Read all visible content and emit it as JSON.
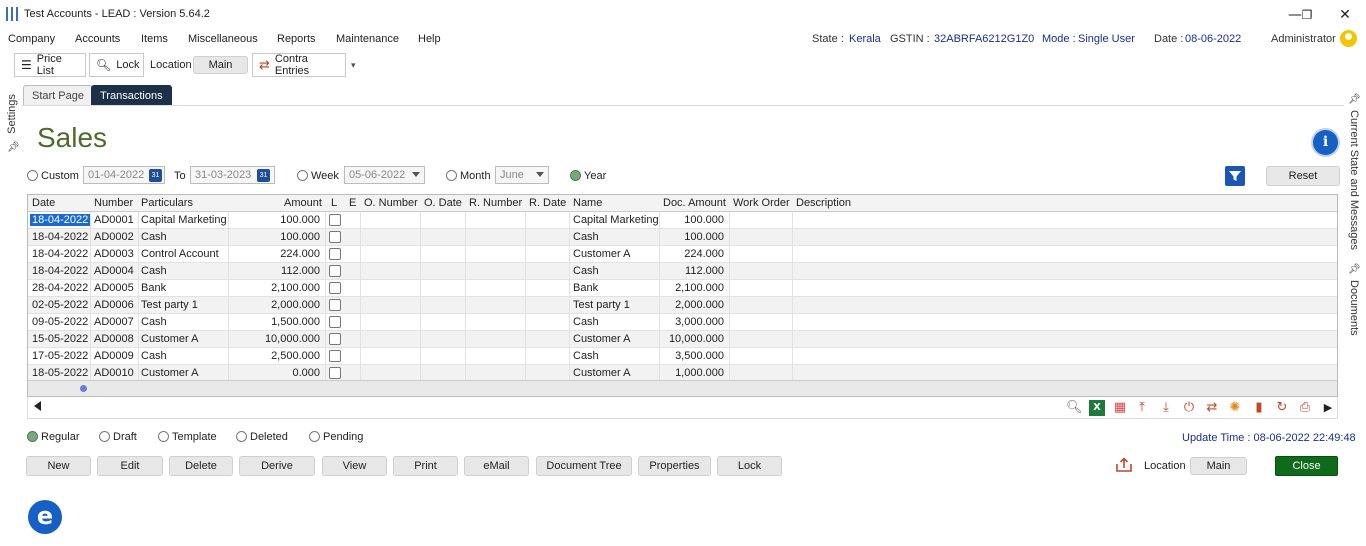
{
  "window": {
    "title": "Test Accounts - LEAD : Version 5.64.2",
    "minimize": "—",
    "maximize": "❐",
    "close": "✕"
  },
  "menu": [
    "Company",
    "Accounts",
    "Items",
    "Miscellaneous",
    "Reports",
    "Maintenance",
    "Help"
  ],
  "status": {
    "state_label": "State :",
    "state_value": "Kerala",
    "gstin_label": "GSTIN :",
    "gstin_value": "32ABRFA6212G1Z0",
    "mode_label": "Mode :",
    "mode_value": "Single User",
    "date_label": "Date :",
    "date_value": "08-06-2022",
    "user": "Administrator"
  },
  "toolbar": {
    "price_list": "Price List",
    "lock": "Lock",
    "location_label": "Location",
    "location_value": "Main",
    "contra": "Contra Entries"
  },
  "side": {
    "settings": "Settings",
    "current_state": "Current State and Messages",
    "documents": "Documents"
  },
  "tabs": [
    "Start Page",
    "Transactions"
  ],
  "page_title": "Sales",
  "filters": {
    "custom": "Custom",
    "from_date": "01-04-2022",
    "to_label": "To",
    "to_date": "31-03-2023",
    "cal_icon_text": "31",
    "week": "Week",
    "week_value": "05-06-2022",
    "month": "Month",
    "month_value": "June",
    "year": "Year",
    "selected": "year",
    "reset": "Reset"
  },
  "table": {
    "columns": [
      "Date",
      "Number",
      "Particulars",
      "Amount",
      "L",
      "E",
      "O. Number",
      "O. Date",
      "R. Number",
      "R. Date",
      "Name",
      "Doc. Amount",
      "Work Order",
      "Description"
    ],
    "rows": [
      {
        "date": "18-04-2022",
        "number": "AD0001",
        "particulars": "Capital Marketing",
        "amount": "100.000",
        "name": "Capital Marketing",
        "doc_amount": "100.000"
      },
      {
        "date": "18-04-2022",
        "number": "AD0002",
        "particulars": "Cash",
        "amount": "100.000",
        "name": "Cash",
        "doc_amount": "100.000"
      },
      {
        "date": "18-04-2022",
        "number": "AD0003",
        "particulars": "Control Account",
        "amount": "224.000",
        "name": "Customer A",
        "doc_amount": "224.000"
      },
      {
        "date": "18-04-2022",
        "number": "AD0004",
        "particulars": "Cash",
        "amount": "112.000",
        "name": "Cash",
        "doc_amount": "112.000"
      },
      {
        "date": "28-04-2022",
        "number": "AD0005",
        "particulars": "Bank",
        "amount": "2,100.000",
        "name": "Bank",
        "doc_amount": "2,100.000"
      },
      {
        "date": "02-05-2022",
        "number": "AD0006",
        "particulars": "Test party 1",
        "amount": "2,000.000",
        "name": "Test party 1",
        "doc_amount": "2,000.000"
      },
      {
        "date": "09-05-2022",
        "number": "AD0007",
        "particulars": "Cash",
        "amount": "1,500.000",
        "name": "Cash",
        "doc_amount": "3,000.000"
      },
      {
        "date": "15-05-2022",
        "number": "AD0008",
        "particulars": "Customer A",
        "amount": "10,000.000",
        "name": "Customer A",
        "doc_amount": "10,000.000"
      },
      {
        "date": "17-05-2022",
        "number": "AD0009",
        "particulars": "Cash",
        "amount": "2,500.000",
        "name": "Cash",
        "doc_amount": "3,500.000"
      },
      {
        "date": "18-05-2022",
        "number": "AD0010",
        "particulars": "Customer A",
        "amount": "0.000",
        "name": "Customer A",
        "doc_amount": "1,000.000"
      }
    ]
  },
  "nav_icons": [
    "search-icon",
    "excel-icon",
    "grid-icon",
    "move-top-icon",
    "move-bottom-icon",
    "power-icon",
    "swap-icon",
    "settings-burst-icon",
    "chart-icon",
    "refresh-icon",
    "print-icon",
    "next-icon"
  ],
  "status_filters": {
    "regular": "Regular",
    "draft": "Draft",
    "template": "Template",
    "deleted": "Deleted",
    "pending": "Pending",
    "selected": "regular"
  },
  "update_time": "Update Time : 08-06-2022  22:49:48",
  "actions": [
    "New",
    "Edit",
    "Delete",
    "Derive",
    "View",
    "Print",
    "eMail",
    "Document Tree",
    "Properties",
    "Lock"
  ],
  "footer": {
    "location_label": "Location",
    "location_value": "Main",
    "close": "Close"
  },
  "brand_letter": "e"
}
